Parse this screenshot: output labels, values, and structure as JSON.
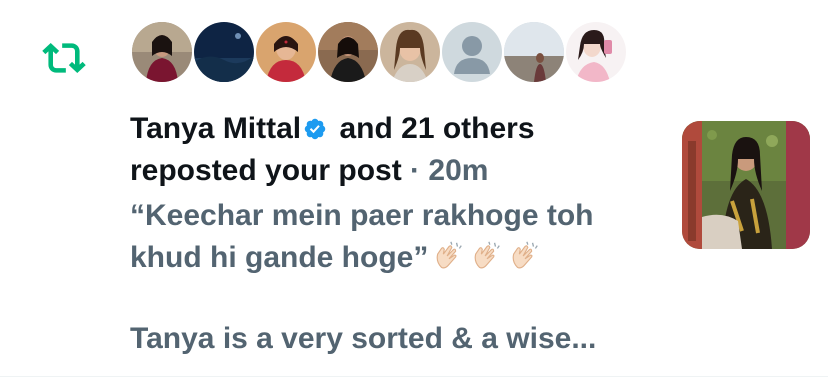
{
  "notification": {
    "user_name": "Tanya Mittal",
    "others_text": "and 21 others",
    "action_text": "reposted your post",
    "separator": "·",
    "time": "20m",
    "post_preview": "“Keechar mein paer rakhoge toh khud hi gande hoge”",
    "post_preview_more": "Tanya is a very sorted & a wise...",
    "avatars_count": 8
  },
  "colors": {
    "repost_green": "#00ba7c",
    "verified_blue": "#1d9bf0",
    "primary_text": "#0f1419",
    "secondary_text": "#536471"
  },
  "icons": {
    "repost": "repost-icon",
    "verified": "verified-badge-icon",
    "clap": "clapping-hands-emoji"
  }
}
